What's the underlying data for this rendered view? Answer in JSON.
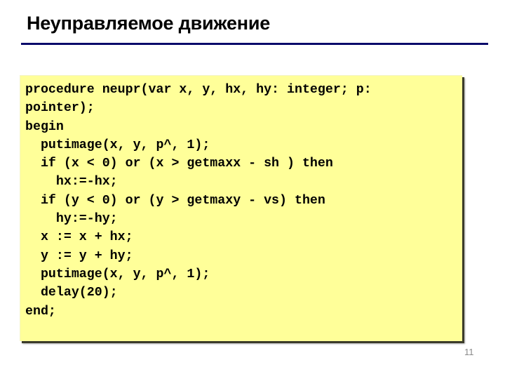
{
  "slide": {
    "title": "Неуправляемое движение",
    "page_number": "11"
  },
  "code": {
    "language": "pascal",
    "lines": [
      "procedure neupr(var x, y, hx, hy: integer; p:",
      "pointer);",
      "begin",
      "  putimage(x, y, p^, 1);",
      "  if (x < 0) or (x > getmaxx - sh ) then",
      "    hx:=-hx;",
      "  if (y < 0) or (y > getmaxy - vs) then",
      "    hy:=-hy;",
      "  x := x + hx;",
      "  y := y + hy;",
      "  putimage(x, y, p^, 1);",
      "  delay(20);",
      "end;"
    ]
  },
  "colors": {
    "title_rule": "#0a0a6b",
    "code_background": "#ffff99",
    "code_text": "#000000",
    "page_number": "#8a8a8a"
  }
}
